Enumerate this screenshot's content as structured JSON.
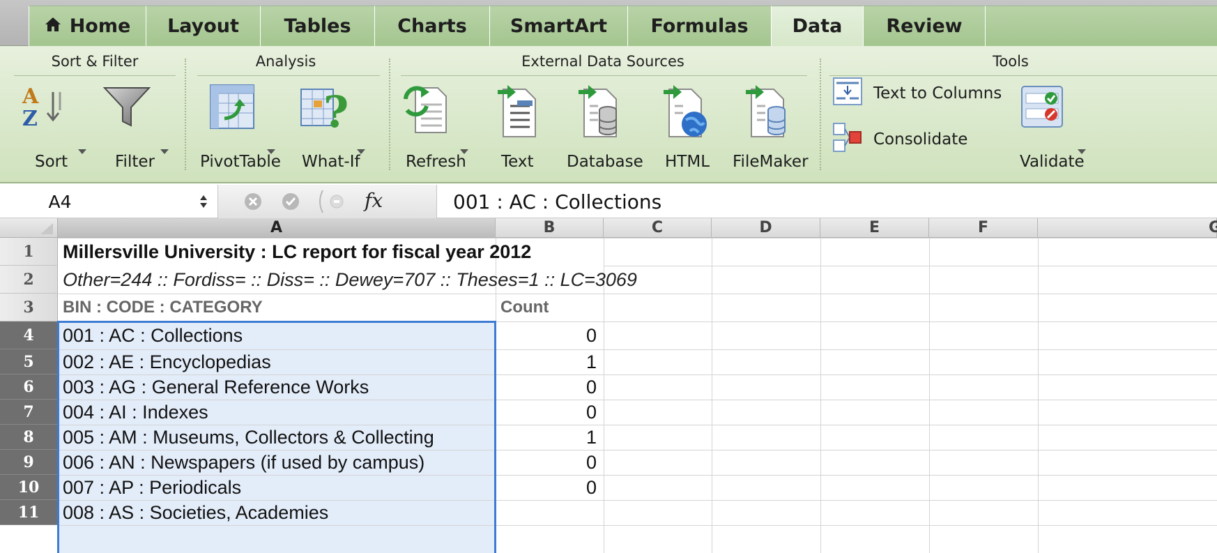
{
  "ribbon_tabs": [
    {
      "label": "Home",
      "icon": "home-icon"
    },
    {
      "label": "Layout"
    },
    {
      "label": "Tables"
    },
    {
      "label": "Charts"
    },
    {
      "label": "SmartArt"
    },
    {
      "label": "Formulas"
    },
    {
      "label": "Data",
      "active": true
    },
    {
      "label": "Review"
    }
  ],
  "ribbon_groups": {
    "sort_filter": "Sort & Filter",
    "analysis": "Analysis",
    "external_data": "External Data Sources",
    "tools": "Tools"
  },
  "ribbon_buttons": {
    "sort": "Sort",
    "filter": "Filter",
    "pivottable": "PivotTable",
    "whatif": "What-If",
    "refresh": "Refresh",
    "text": "Text",
    "database": "Database",
    "html": "HTML",
    "filemaker": "FileMaker",
    "text_to_columns": "Text to Columns",
    "consolidate": "Consolidate",
    "validate": "Validate"
  },
  "formula_bar": {
    "name_box": "A4",
    "fx_symbol": "fx",
    "formula": "001 : AC : Collections"
  },
  "columns": [
    "A",
    "B",
    "C",
    "D",
    "E",
    "F",
    "G"
  ],
  "selected_column": "A",
  "rows": [
    {
      "num": "1",
      "a": "Millersville University : LC report for fiscal year 2012",
      "b": "",
      "style": "bold"
    },
    {
      "num": "2",
      "a": "Other=244 :: Fordiss= :: Diss= :: Dewey=707 :: Theses=1 :: LC=3069",
      "b": "",
      "style": "italic"
    },
    {
      "num": "3",
      "a": "BIN : CODE : CATEGORY",
      "b": "Count",
      "style": "header"
    },
    {
      "num": "4",
      "a": "001 : AC : Collections",
      "b": "0",
      "selected": true
    },
    {
      "num": "5",
      "a": "002 : AE : Encyclopedias",
      "b": "1",
      "selected": true
    },
    {
      "num": "6",
      "a": "003 : AG : General Reference Works",
      "b": "0",
      "selected": true
    },
    {
      "num": "7",
      "a": "004 : AI : Indexes",
      "b": "0",
      "selected": true
    },
    {
      "num": "8",
      "a": "005 : AM : Museums, Collectors & Collecting",
      "b": "1",
      "selected": true
    },
    {
      "num": "9",
      "a": "006 : AN : Newspapers (if used by campus)",
      "b": "0",
      "selected": true
    },
    {
      "num": "10",
      "a": "007 : AP : Periodicals",
      "b": "0",
      "selected": true
    },
    {
      "num": "11",
      "a": "008 : AS : Societies, Academies",
      "b": "",
      "selected": true
    }
  ],
  "colors": {
    "ribbon_green": "#cfe2bd",
    "selection_border": "#3d7bd4",
    "selection_fill": "#e3ecf9",
    "header_text_gray": "#666666"
  }
}
